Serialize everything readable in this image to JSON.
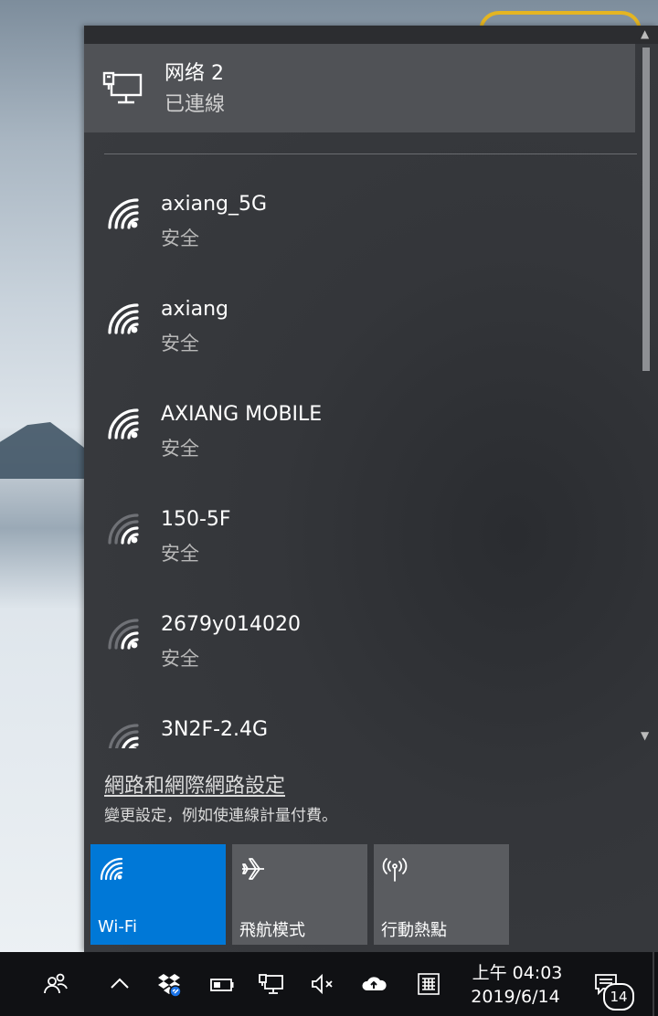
{
  "connected_network": {
    "name": "网络 2",
    "status": "已連線",
    "icon": "ethernet-monitor-icon"
  },
  "networks": [
    {
      "name": "axiang_5G",
      "security": "安全",
      "signal": "full"
    },
    {
      "name": "axiang",
      "security": "安全",
      "signal": "full"
    },
    {
      "name": "AXIANG MOBILE",
      "security": "安全",
      "signal": "full"
    },
    {
      "name": "150-5F",
      "security": "安全",
      "signal": "weak"
    },
    {
      "name": "2679y014020",
      "security": "安全",
      "signal": "weak"
    },
    {
      "name": "3N2F-2.4G",
      "security": "",
      "signal": "weak"
    }
  ],
  "settings": {
    "link": "網路和網際網路設定",
    "description": "變更設定，例如使連線計量付費。"
  },
  "quick_actions": [
    {
      "label": "Wi-Fi",
      "icon": "wifi-icon",
      "active": true
    },
    {
      "label": "飛航模式",
      "icon": "airplane-icon",
      "active": false
    },
    {
      "label": "行動熱點",
      "icon": "hotspot-icon",
      "active": false
    }
  ],
  "taskbar": {
    "time": "上午 04:03",
    "date": "2019/6/14",
    "notification_count": "14",
    "icons": [
      "people-icon",
      "chevron-up-icon",
      "dropbox-icon",
      "battery-icon",
      "network-icon",
      "volume-muted-icon",
      "onedrive-icon",
      "keyboard-icon",
      "action-center-icon"
    ]
  },
  "colors": {
    "accent": "#0078d7",
    "flyout_bg": "#35373b",
    "connected_bg": "#505256",
    "tile_bg": "#5a5c60",
    "taskbar_bg": "#101114"
  }
}
